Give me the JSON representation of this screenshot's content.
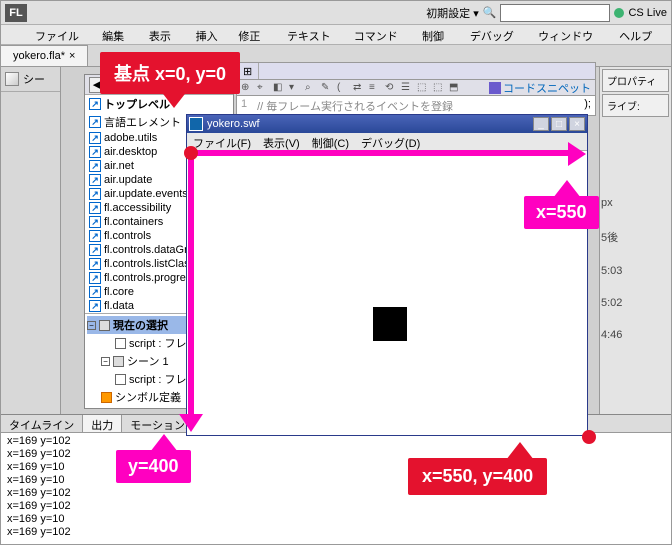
{
  "app": {
    "logo": "FL"
  },
  "topbar": {
    "layout_dropdown": "初期設定 ▾",
    "search_icon": "🔍",
    "cslive": "CS Live"
  },
  "menubar": {
    "items": [
      "ファイル(F)",
      "編集(E)",
      "表示(V)",
      "挿入(I)",
      "修正(M)",
      "テキスト(T)",
      "コマンド(C)",
      "制御(O)",
      "デバッグ(D)",
      "ウィンドウ(W)",
      "ヘルプ(H)"
    ]
  },
  "doc_tabs": {
    "tab1": "yokero.fla*",
    "close_glyph": "×"
  },
  "scene": {
    "label": "シー"
  },
  "right_panel": {
    "r1": "プロパティ",
    "r2": "ライブ:"
  },
  "popup": {
    "nav_back": "◀",
    "nav_fwd": "▶",
    "top_level": "トップレベル",
    "items": [
      "言語エレメント",
      "adobe.utils",
      "air.desktop",
      "air.net",
      "air.update",
      "air.update.events",
      "fl.accessibility",
      "fl.containers",
      "fl.controls",
      "fl.controls.dataGridCla:",
      "fl.controls.listClasses",
      "fl.controls.progressBar",
      "fl.core",
      "fl.data"
    ],
    "tree": {
      "heading": "現在の選択",
      "n1": "script : フレーム",
      "scene": "シーン 1",
      "n2": "script : フレーム",
      "sym": "シンボル定義"
    }
  },
  "doc_icons": [
    "⊕",
    "⌖",
    "◧",
    "▾",
    "⌕",
    "✎",
    "(",
    "⇄",
    "≡",
    "⟲",
    "☰",
    "⬚",
    "⬚",
    "⬒"
  ],
  "code": {
    "snippet_label": "コードスニペット",
    "line_no": "1",
    "comment": "// 毎フレーム実行されるイベントを登録",
    "tail": ");"
  },
  "swf": {
    "title": "yokero.swf",
    "menu": [
      "ファイル(F)",
      "表示(V)",
      "制御(C)",
      "デバッグ(D)"
    ],
    "win_min": "_",
    "win_max": "□",
    "win_close": "×"
  },
  "anno": {
    "origin": "基点 x=0, y=0",
    "xmax": "x=550",
    "ymax": "y=400",
    "corner": "x=550, y=400"
  },
  "bottom": {
    "tabs": [
      "タイムライン",
      "出力",
      "モーションエディター"
    ],
    "lines": [
      "x=169  y=102",
      "x=169  y=102",
      "x=169  y=10",
      "x=169  y=10",
      "x=169  y=102",
      "x=169  y=102",
      "x=169  y=10",
      "x=169  y=102"
    ]
  },
  "props": {
    "px": "px",
    "t1": "5後",
    "t2": "5:03",
    "t3": "5:02",
    "t4": "4:46"
  }
}
